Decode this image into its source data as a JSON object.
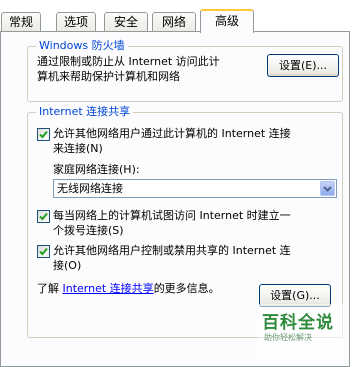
{
  "tabs": [
    {
      "label": "常规"
    },
    {
      "label": "选项"
    },
    {
      "label": "安全"
    },
    {
      "label": "网络"
    },
    {
      "label": "高级"
    }
  ],
  "active_tab": "高级",
  "firewall": {
    "title": "Windows 防火墙",
    "desc_line1": "通过限制或防止从 Internet 访问此计",
    "desc_line2": "算机来帮助保护计算机和网络",
    "settings_button": "设置(E)..."
  },
  "ics": {
    "title": "Internet 连接共享",
    "allow_connect_line1": "允许其他网络用户通过此计算机的 Internet 连接",
    "allow_connect_line2": "来连接(N)",
    "allow_connect_checked": true,
    "home_network_label": "家庭网络连接(H):",
    "home_network_value": "无线网络连接",
    "dial_on_demand_line1": "每当网络上的计算机试图访问 Internet 时建立一",
    "dial_on_demand_line2": "个拨号连接(S)",
    "dial_on_demand_checked": true,
    "allow_control_line1": "允许其他网络用户控制或禁用共享的 Internet 连",
    "allow_control_line2": "接(O)",
    "allow_control_checked": true,
    "learn_prefix": "了解",
    "learn_link": "Internet 连接共享",
    "learn_suffix": "的更多信息。",
    "settings_button": "设置(G)..."
  },
  "watermark": {
    "logo": "百科全说",
    "sub": "助你轻松解决"
  },
  "colors": {
    "group_title": "#0046d5",
    "active_tab_accent": "#ffc83c",
    "link": "#0000ff"
  }
}
